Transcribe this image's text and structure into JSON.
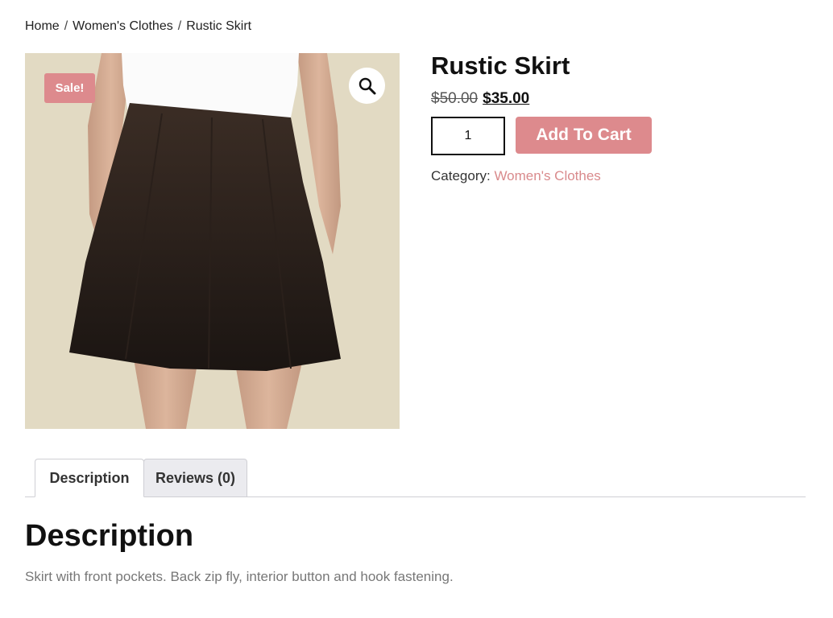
{
  "breadcrumb": {
    "items": [
      "Home",
      "Women's Clothes",
      "Rustic Skirt"
    ],
    "separator": "/"
  },
  "product": {
    "title": "Rustic Skirt",
    "sale_badge": "Sale!",
    "regular_price": "$50.00",
    "sale_price": "$35.00",
    "quantity": "1",
    "add_to_cart_label": "Add To Cart",
    "category_label": "Category:",
    "category_value": "Women's Clothes",
    "image_zoom_icon": "magnifier-icon"
  },
  "tabs": [
    {
      "label": "Description",
      "active": true
    },
    {
      "label": "Reviews (0)",
      "active": false
    }
  ],
  "description": {
    "heading": "Description",
    "text": "Skirt with front pockets. Back zip fly, interior button and hook fastening."
  },
  "colors": {
    "accent": "#dd8a8d",
    "link": "#d98a8c",
    "tab_inactive_bg": "#ebebef"
  }
}
